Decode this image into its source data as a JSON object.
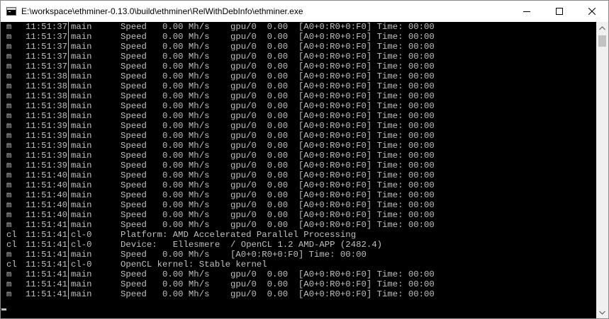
{
  "window": {
    "title": "E:\\workspace\\ethminer-0.13.0\\build\\ethminer\\RelWithDebInfo\\ethminer.exe",
    "icon": "console-app-icon",
    "controls": [
      "minimize-icon",
      "maximize-icon",
      "close-icon"
    ]
  },
  "console": {
    "foreground": "#c0c0c0",
    "background": "#000000",
    "lines": [
      {
        "level": "m",
        "time": "11:51:37",
        "source": "main",
        "message": "Speed   0.00 Mh/s    gpu/0  0.00  [A0+0:R0+0:F0] Time: 00:00"
      },
      {
        "level": "m",
        "time": "11:51:37",
        "source": "main",
        "message": "Speed   0.00 Mh/s    gpu/0  0.00  [A0+0:R0+0:F0] Time: 00:00"
      },
      {
        "level": "m",
        "time": "11:51:37",
        "source": "main",
        "message": "Speed   0.00 Mh/s    gpu/0  0.00  [A0+0:R0+0:F0] Time: 00:00"
      },
      {
        "level": "m",
        "time": "11:51:37",
        "source": "main",
        "message": "Speed   0.00 Mh/s    gpu/0  0.00  [A0+0:R0+0:F0] Time: 00:00"
      },
      {
        "level": "m",
        "time": "11:51:37",
        "source": "main",
        "message": "Speed   0.00 Mh/s    gpu/0  0.00  [A0+0:R0+0:F0] Time: 00:00"
      },
      {
        "level": "m",
        "time": "11:51:38",
        "source": "main",
        "message": "Speed   0.00 Mh/s    gpu/0  0.00  [A0+0:R0+0:F0] Time: 00:00"
      },
      {
        "level": "m",
        "time": "11:51:38",
        "source": "main",
        "message": "Speed   0.00 Mh/s    gpu/0  0.00  [A0+0:R0+0:F0] Time: 00:00"
      },
      {
        "level": "m",
        "time": "11:51:38",
        "source": "main",
        "message": "Speed   0.00 Mh/s    gpu/0  0.00  [A0+0:R0+0:F0] Time: 00:00"
      },
      {
        "level": "m",
        "time": "11:51:38",
        "source": "main",
        "message": "Speed   0.00 Mh/s    gpu/0  0.00  [A0+0:R0+0:F0] Time: 00:00"
      },
      {
        "level": "m",
        "time": "11:51:38",
        "source": "main",
        "message": "Speed   0.00 Mh/s    gpu/0  0.00  [A0+0:R0+0:F0] Time: 00:00"
      },
      {
        "level": "m",
        "time": "11:51:39",
        "source": "main",
        "message": "Speed   0.00 Mh/s    gpu/0  0.00  [A0+0:R0+0:F0] Time: 00:00"
      },
      {
        "level": "m",
        "time": "11:51:39",
        "source": "main",
        "message": "Speed   0.00 Mh/s    gpu/0  0.00  [A0+0:R0+0:F0] Time: 00:00"
      },
      {
        "level": "m",
        "time": "11:51:39",
        "source": "main",
        "message": "Speed   0.00 Mh/s    gpu/0  0.00  [A0+0:R0+0:F0] Time: 00:00"
      },
      {
        "level": "m",
        "time": "11:51:39",
        "source": "main",
        "message": "Speed   0.00 Mh/s    gpu/0  0.00  [A0+0:R0+0:F0] Time: 00:00"
      },
      {
        "level": "m",
        "time": "11:51:39",
        "source": "main",
        "message": "Speed   0.00 Mh/s    gpu/0  0.00  [A0+0:R0+0:F0] Time: 00:00"
      },
      {
        "level": "m",
        "time": "11:51:40",
        "source": "main",
        "message": "Speed   0.00 Mh/s    gpu/0  0.00  [A0+0:R0+0:F0] Time: 00:00"
      },
      {
        "level": "m",
        "time": "11:51:40",
        "source": "main",
        "message": "Speed   0.00 Mh/s    gpu/0  0.00  [A0+0:R0+0:F0] Time: 00:00"
      },
      {
        "level": "m",
        "time": "11:51:40",
        "source": "main",
        "message": "Speed   0.00 Mh/s    gpu/0  0.00  [A0+0:R0+0:F0] Time: 00:00"
      },
      {
        "level": "m",
        "time": "11:51:40",
        "source": "main",
        "message": "Speed   0.00 Mh/s    gpu/0  0.00  [A0+0:R0+0:F0] Time: 00:00"
      },
      {
        "level": "m",
        "time": "11:51:40",
        "source": "main",
        "message": "Speed   0.00 Mh/s    gpu/0  0.00  [A0+0:R0+0:F0] Time: 00:00"
      },
      {
        "level": "m",
        "time": "11:51:41",
        "source": "main",
        "message": "Speed   0.00 Mh/s    gpu/0  0.00  [A0+0:R0+0:F0] Time: 00:00"
      },
      {
        "level": "cl",
        "time": "11:51:41",
        "source": "cl-0",
        "message": "Platform: AMD Accelerated Parallel Processing"
      },
      {
        "level": "cl",
        "time": "11:51:41",
        "source": "cl-0",
        "message": "Device:   Ellesmere  / OpenCL 1.2 AMD-APP (2482.4)"
      },
      {
        "level": "m",
        "time": "11:51:41",
        "source": "main",
        "message": "Speed   0.00 Mh/s    [A0+0:R0+0:F0] Time: 00:00"
      },
      {
        "level": "cl",
        "time": "11:51:41",
        "source": "cl-0",
        "message": "OpenCL kernel: Stable kernel"
      },
      {
        "level": "m",
        "time": "11:51:41",
        "source": "main",
        "message": "Speed   0.00 Mh/s    gpu/0  0.00  [A0+0:R0+0:F0] Time: 00:00"
      },
      {
        "level": "m",
        "time": "11:51:41",
        "source": "main",
        "message": "Speed   0.00 Mh/s    gpu/0  0.00  [A0+0:R0+0:F0] Time: 00:00"
      },
      {
        "level": "m",
        "time": "11:51:41",
        "source": "main",
        "message": "Speed   0.00 Mh/s    gpu/0  0.00  [A0+0:R0+0:F0] Time: 00:00"
      }
    ]
  },
  "scrollbar": {
    "up_icon": "scroll-up-arrow-icon",
    "down_icon": "scroll-down-arrow-icon"
  }
}
